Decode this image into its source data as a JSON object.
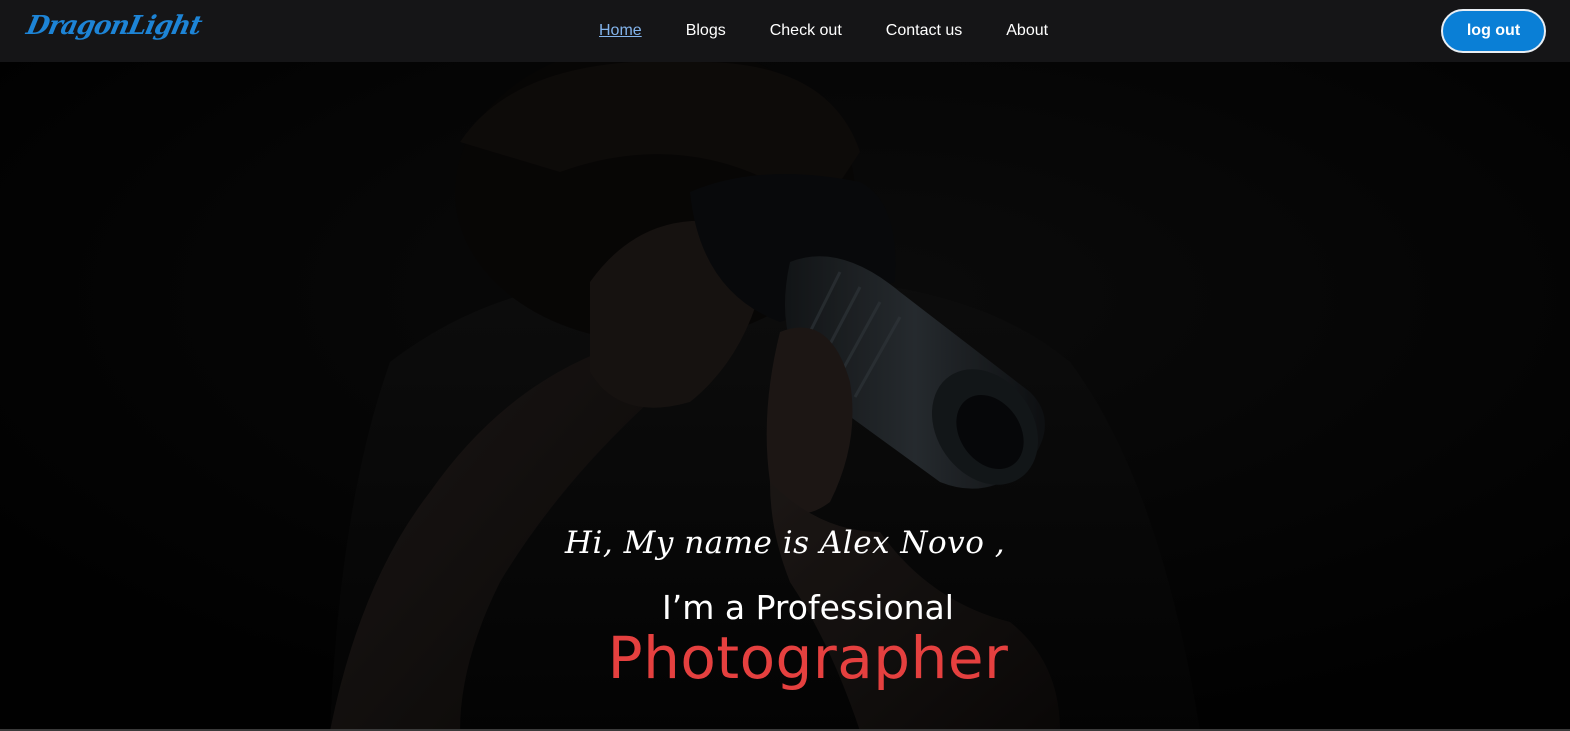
{
  "brand": {
    "logo_text": "DragonLight",
    "accent_color": "#0a7fd6"
  },
  "nav": {
    "items": [
      {
        "label": "Home",
        "active": true
      },
      {
        "label": "Blogs",
        "active": false
      },
      {
        "label": "Check out",
        "active": false
      },
      {
        "label": "Contact us",
        "active": false
      },
      {
        "label": "About",
        "active": false
      }
    ]
  },
  "header": {
    "logout_label": "log out"
  },
  "hero": {
    "greeting": "Hi, My name is Alex Novo ,",
    "subtitle": "I’m a Professional",
    "headline": "Photographer",
    "headline_color": "#e5403f",
    "background_image": "photographer-with-camera"
  }
}
